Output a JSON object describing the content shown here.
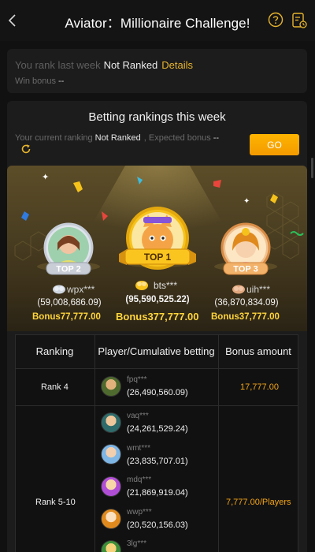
{
  "header": {
    "title": "Aviator：Millionaire Challenge!"
  },
  "last_week": {
    "label": "You rank last week",
    "rank": "Not Ranked",
    "details_link": "Details",
    "win_bonus_label": "Win bonus",
    "win_bonus_value": "--"
  },
  "this_week": {
    "title": "Betting rankings this week",
    "current_ranking_label": "Your current ranking",
    "current_ranking_value": "Not Ranked",
    "expected_bonus_label": ", Expected bonus",
    "expected_bonus_value": "--",
    "go_button": "GO"
  },
  "podium": {
    "top2": {
      "badge": "TOP 2",
      "name": "wpx***",
      "amount": "(59,008,686.09)",
      "bonus_label": "Bonus",
      "bonus_value": "77,777.00"
    },
    "top1": {
      "badge": "TOP 1",
      "name": "bts***",
      "amount": "(95,590,525.22)",
      "bonus_label": "Bonus",
      "bonus_value": "377,777.00"
    },
    "top3": {
      "badge": "TOP 3",
      "name": "uih***",
      "amount": "(36,870,834.09)",
      "bonus_label": "Bonus",
      "bonus_value": "37,777.00"
    }
  },
  "table": {
    "headers": [
      "Ranking",
      "Player/Cumulative betting",
      "Bonus amount"
    ],
    "rank4": {
      "rank": "Rank 4",
      "name": "fpq***",
      "amount": "(26,490,560.09)",
      "bonus": "17,777.00"
    },
    "rank5_10": {
      "rank": "Rank 5-10",
      "bonus": "7,777.00/Players",
      "players": [
        {
          "name": "vaq***",
          "amount": "(24,261,529.24)"
        },
        {
          "name": "wmt***",
          "amount": "(23,835,707.01)"
        },
        {
          "name": "mdq***",
          "amount": "(21,869,919.04)"
        },
        {
          "name": "wwp***",
          "amount": "(20,520,156.03)"
        },
        {
          "name": "3lg***",
          "amount": ""
        }
      ]
    }
  },
  "colors": {
    "accent": "#f5a516",
    "gold_text": "#ffd53b",
    "go_button": "#ffb400"
  }
}
